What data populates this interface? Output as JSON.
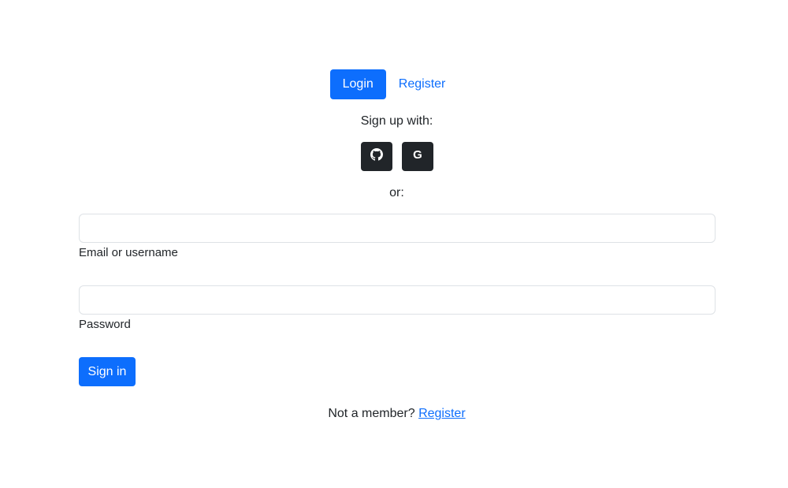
{
  "tabs": {
    "login_label": "Login",
    "register_label": "Register"
  },
  "signup": {
    "prompt": "Sign up with:",
    "providers": [
      {
        "name": "github",
        "icon": "github-icon"
      },
      {
        "name": "google",
        "icon": "google-icon",
        "glyph": "G"
      }
    ]
  },
  "divider_text": "or:",
  "form": {
    "email": {
      "label": "Email or username",
      "value": ""
    },
    "password": {
      "label": "Password",
      "value": ""
    },
    "submit_label": "Sign in"
  },
  "footer": {
    "prompt": "Not a member?",
    "link_label": "Register"
  },
  "colors": {
    "primary": "#0d6efd",
    "dark": "#212529",
    "border": "#dee2e6"
  }
}
